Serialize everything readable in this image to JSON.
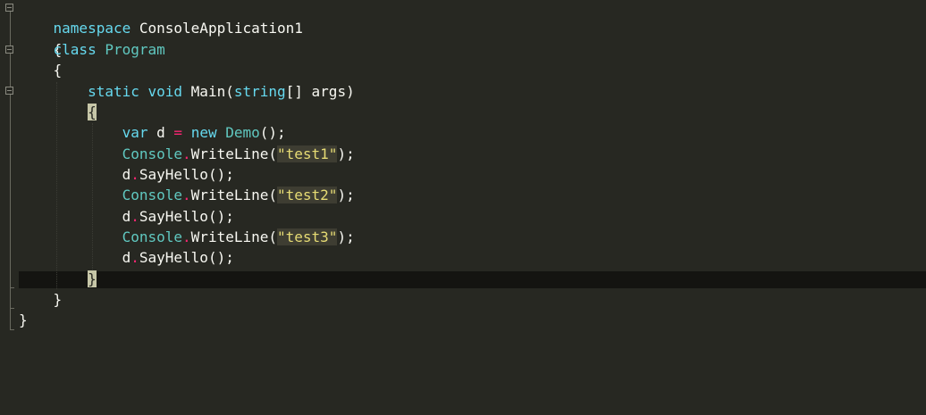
{
  "editor": {
    "lines": {
      "l1_kw": "namespace",
      "l1_name": "ConsoleApplication1",
      "l2": "{",
      "l3_kw": "class",
      "l3_name": "Program",
      "l4": "{",
      "l5_kw1": "static",
      "l5_kw2": "void",
      "l5_name": "Main(",
      "l5_type": "string",
      "l5_rest": "[] args)",
      "l6": "{",
      "l7_kw": "var",
      "l7_a": "d",
      "l7_op": "=",
      "l7_new": "new",
      "l7_type": "Demo",
      "l7_end": "();",
      "l8_type": "Console",
      "l8_dot": ".",
      "l8_method": "WriteLine(",
      "l8_str": "\"test1\"",
      "l8_end": ");",
      "l9_var": "d",
      "l9_dot": ".",
      "l9_call": "SayHello();",
      "l10_type": "Console",
      "l10_dot": ".",
      "l10_method": "WriteLine(",
      "l10_str": "\"test2\"",
      "l10_end": ");",
      "l11_var": "d",
      "l11_dot": ".",
      "l11_call": "SayHello();",
      "l12_type": "Console",
      "l12_dot": ".",
      "l12_method": "WriteLine(",
      "l12_str": "\"test3\"",
      "l12_end": ");",
      "l13_var": "d",
      "l13_dot": ".",
      "l13_call": "SayHello();",
      "l14": "}",
      "l15": "}",
      "l16": "}"
    }
  },
  "colors": {
    "background": "#272822",
    "current_line": "#141411",
    "keyword": "#8be9fd",
    "type": "#60c8c0",
    "string": "#e6db74",
    "operator": "#f92672"
  }
}
